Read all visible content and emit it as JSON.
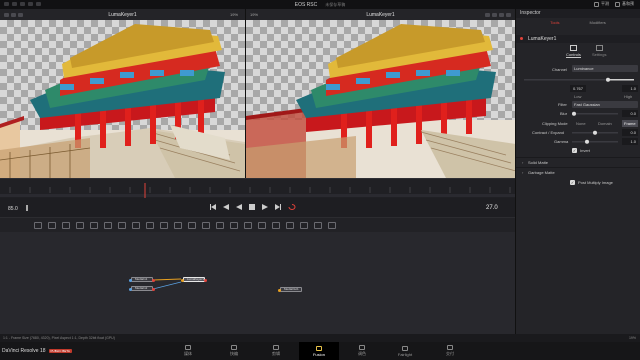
{
  "window": {
    "title": "EOS RSC",
    "subtitle": "未保存草稿"
  },
  "top_right": {
    "fx_label": "平测",
    "project_label": "基和预"
  },
  "viewer_left": {
    "title": "LumaKeyer1",
    "zoom": "19%",
    "resolution": "7680x4320xfloat32"
  },
  "viewer_right": {
    "title": "LumaKeyer1",
    "zoom": "19%"
  },
  "playback": {
    "start_frame": "85.0",
    "current_frame": "27.0"
  },
  "nodes": [
    {
      "label": "MediaIn1"
    },
    {
      "label": "MediaIn2"
    },
    {
      "label": "LumaKeyer1"
    },
    {
      "label": "MediaOut1"
    }
  ],
  "status_bar": {
    "text": "1:1 - Frame Size (7680, 4320), Pixel Aspect 1:1, Depth 32bit float (GPU)",
    "right": "19%"
  },
  "brand": {
    "name": "DaVinci Resolve 18",
    "badge": "PUBLIC BETA"
  },
  "pages": [
    {
      "label": "媒体",
      "icon": "media-icon"
    },
    {
      "label": "快编",
      "icon": "cut-icon"
    },
    {
      "label": "剪辑",
      "icon": "edit-icon"
    },
    {
      "label": "Fusion",
      "icon": "fusion-icon"
    },
    {
      "label": "调色",
      "icon": "color-icon"
    },
    {
      "label": "Fairlight",
      "icon": "fairlight-icon"
    },
    {
      "label": "交付",
      "icon": "deliver-icon"
    }
  ],
  "inspector": {
    "title": "Inspector",
    "tabs": [
      "Tools",
      "Modifiers"
    ],
    "tool_name": "LumaKeyer1",
    "subtabs": [
      "Controls",
      "Settings"
    ],
    "channel_label": "Channel",
    "channel_value": "Luminance",
    "low_value": "0.767",
    "high_value": "1.0",
    "low_label": "Low",
    "high_label": "High",
    "filter_label": "Filter",
    "filter_value": "Fast Gaussian",
    "blur_label": "Blur",
    "blur_value": "0.0",
    "clipping_label": "Clipping Mode",
    "clipping_options": [
      "None",
      "Domain",
      "Frame"
    ],
    "contract_label": "Contract / Expand",
    "contract_value": "0.0",
    "gamma_label": "Gamma",
    "gamma_value": "1.0",
    "invert_label": "Invert",
    "solid_matte": "Solid Matte",
    "garbage_matte": "Garbage Matte",
    "post_multiply": "Post Multiply Image"
  },
  "colors": {
    "accent_red": "#e0423a",
    "keyframe_orange": "#e8a020",
    "fusion_active": "#e8c34a"
  }
}
